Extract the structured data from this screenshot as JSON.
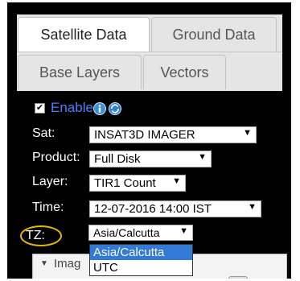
{
  "tabs": [
    {
      "label": "Satellite Data",
      "active": true
    },
    {
      "label": "Ground Data",
      "active": false
    },
    {
      "label": "Base Layers",
      "active": false
    },
    {
      "label": "Vectors",
      "active": false
    }
  ],
  "enable": {
    "label": "Enable",
    "checked": true
  },
  "fields": {
    "sat": {
      "label": "Sat:",
      "value": "INSAT3D IMAGER"
    },
    "product": {
      "label": "Product:",
      "value": "Full Disk"
    },
    "layer": {
      "label": "Layer:",
      "value": "TIR1 Count"
    },
    "time": {
      "label": "Time:",
      "value": "12-07-2016 14:00 IST"
    },
    "tz": {
      "label": "TZ:",
      "value": "Asia/Calcutta"
    }
  },
  "tz_options": [
    "Asia/Calcutta",
    "UTC"
  ],
  "accordion": {
    "label": "Imag"
  },
  "colors": {
    "accent_blue": "#3379d6",
    "highlight": "#e8b900",
    "enable_text": "#4f7fff"
  },
  "icons": {
    "info": "info-icon",
    "refresh": "refresh-icon",
    "collapse": "triangle-down-icon",
    "dropdown": "dropdown-arrow-icon"
  }
}
